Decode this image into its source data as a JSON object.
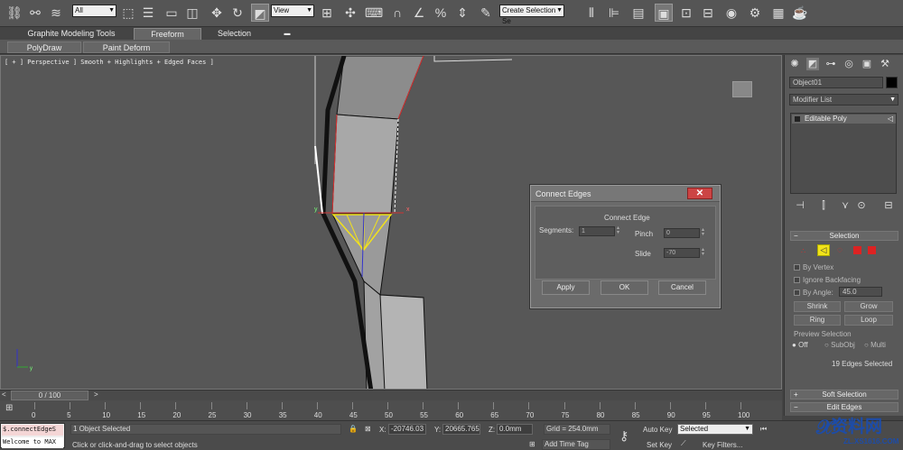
{
  "toolbar": {
    "selection_filter": "All",
    "reference_coord": "View",
    "named_selection": "Create Selection Se"
  },
  "ribbon": {
    "tabs": [
      "Graphite Modeling Tools",
      "Freeform",
      "Selection"
    ],
    "panels": [
      "PolyDraw",
      "Paint Deform"
    ]
  },
  "viewport": {
    "label": "[ + ] Perspective ] Smooth + Highlights + Edged Faces ]"
  },
  "dialog": {
    "title": "Connect Edges",
    "close": "✕",
    "group_label": "Connect Edge",
    "segments_label": "Segments:",
    "segments_value": "1",
    "pinch_label": "Pinch",
    "pinch_value": "0",
    "slide_label": "Slide",
    "slide_value": "-70",
    "apply": "Apply",
    "ok": "OK",
    "cancel": "Cancel"
  },
  "command_panel": {
    "object_name": "Object01",
    "modifier_list": "Modifier List",
    "stack_item": "Editable Poly",
    "selection_rollout": "Selection",
    "by_vertex": "By Vertex",
    "ignore_backfacing": "Ignore Backfacing",
    "by_angle": "By Angle:",
    "by_angle_value": "45.0",
    "shrink": "Shrink",
    "grow": "Grow",
    "ring": "Ring",
    "loop": "Loop",
    "preview_selection": "Preview Selection",
    "preview_off": "Off",
    "preview_subobj": "SubObj",
    "preview_multi": "Multi",
    "status": "19 Edges Selected",
    "soft_selection": "Soft Selection",
    "edit_edges": "Edit Edges"
  },
  "timeline": {
    "frame_display": "0 / 100",
    "ticks": [
      "0",
      "5",
      "10",
      "15",
      "20",
      "25",
      "30",
      "35",
      "40",
      "45",
      "50",
      "55",
      "60",
      "65",
      "70",
      "75",
      "80",
      "85",
      "90",
      "95",
      "100"
    ]
  },
  "statusbar": {
    "script_line1": "$.connectEdgeS",
    "script_line2": "Welcome to MAX",
    "objects_selected": "1 Object Selected",
    "prompt": "Click or click-and-drag to select objects",
    "x_label": "X:",
    "x_value": "-20746.03",
    "y_label": "Y:",
    "y_value": "20665.765",
    "z_label": "Z:",
    "z_value": "0.0mm",
    "grid": "Grid = 254.0mm",
    "auto_key": "Auto Key",
    "selected": "Selected",
    "set_key": "Set Key",
    "key_filters": "Key Filters...",
    "add_time_tag": "Add Time Tag"
  },
  "watermark": {
    "line1": "资料网",
    "line2": "ZL.XS1616.COM"
  },
  "colors": {
    "selection_yellow": "#f2e21a",
    "close_red": "#c44444"
  }
}
